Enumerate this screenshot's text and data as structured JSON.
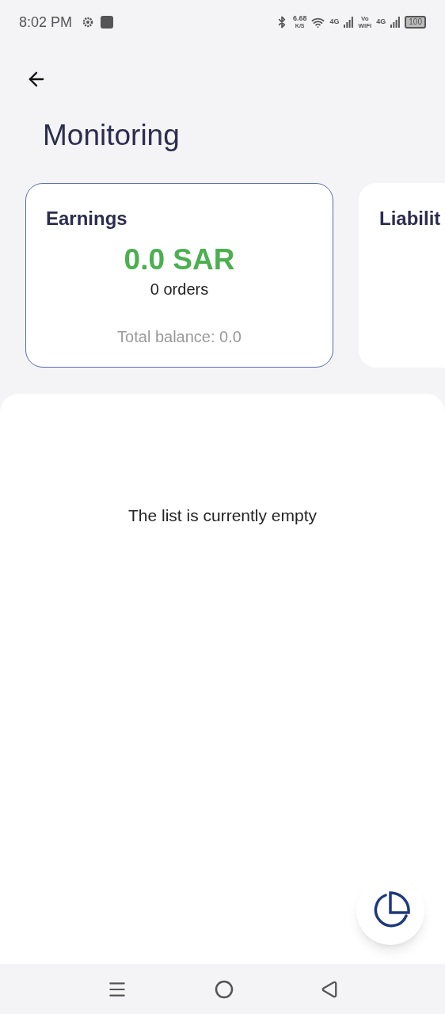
{
  "status_bar": {
    "time": "8:02 PM",
    "speed_value": "6.68",
    "speed_unit": "K/S",
    "network_1": "4G",
    "vowifi_top": "Vo",
    "vowifi_bottom": "WiFi",
    "network_2": "4G",
    "battery": "100"
  },
  "title": "Monitoring",
  "cards": [
    {
      "title": "Earnings",
      "selected": true,
      "amount": "0.0 SAR",
      "orders": "0 orders",
      "balance": "Total balance: 0.0"
    },
    {
      "title": "Liabilit",
      "selected": false
    }
  ],
  "empty_message": "The list is currently empty"
}
